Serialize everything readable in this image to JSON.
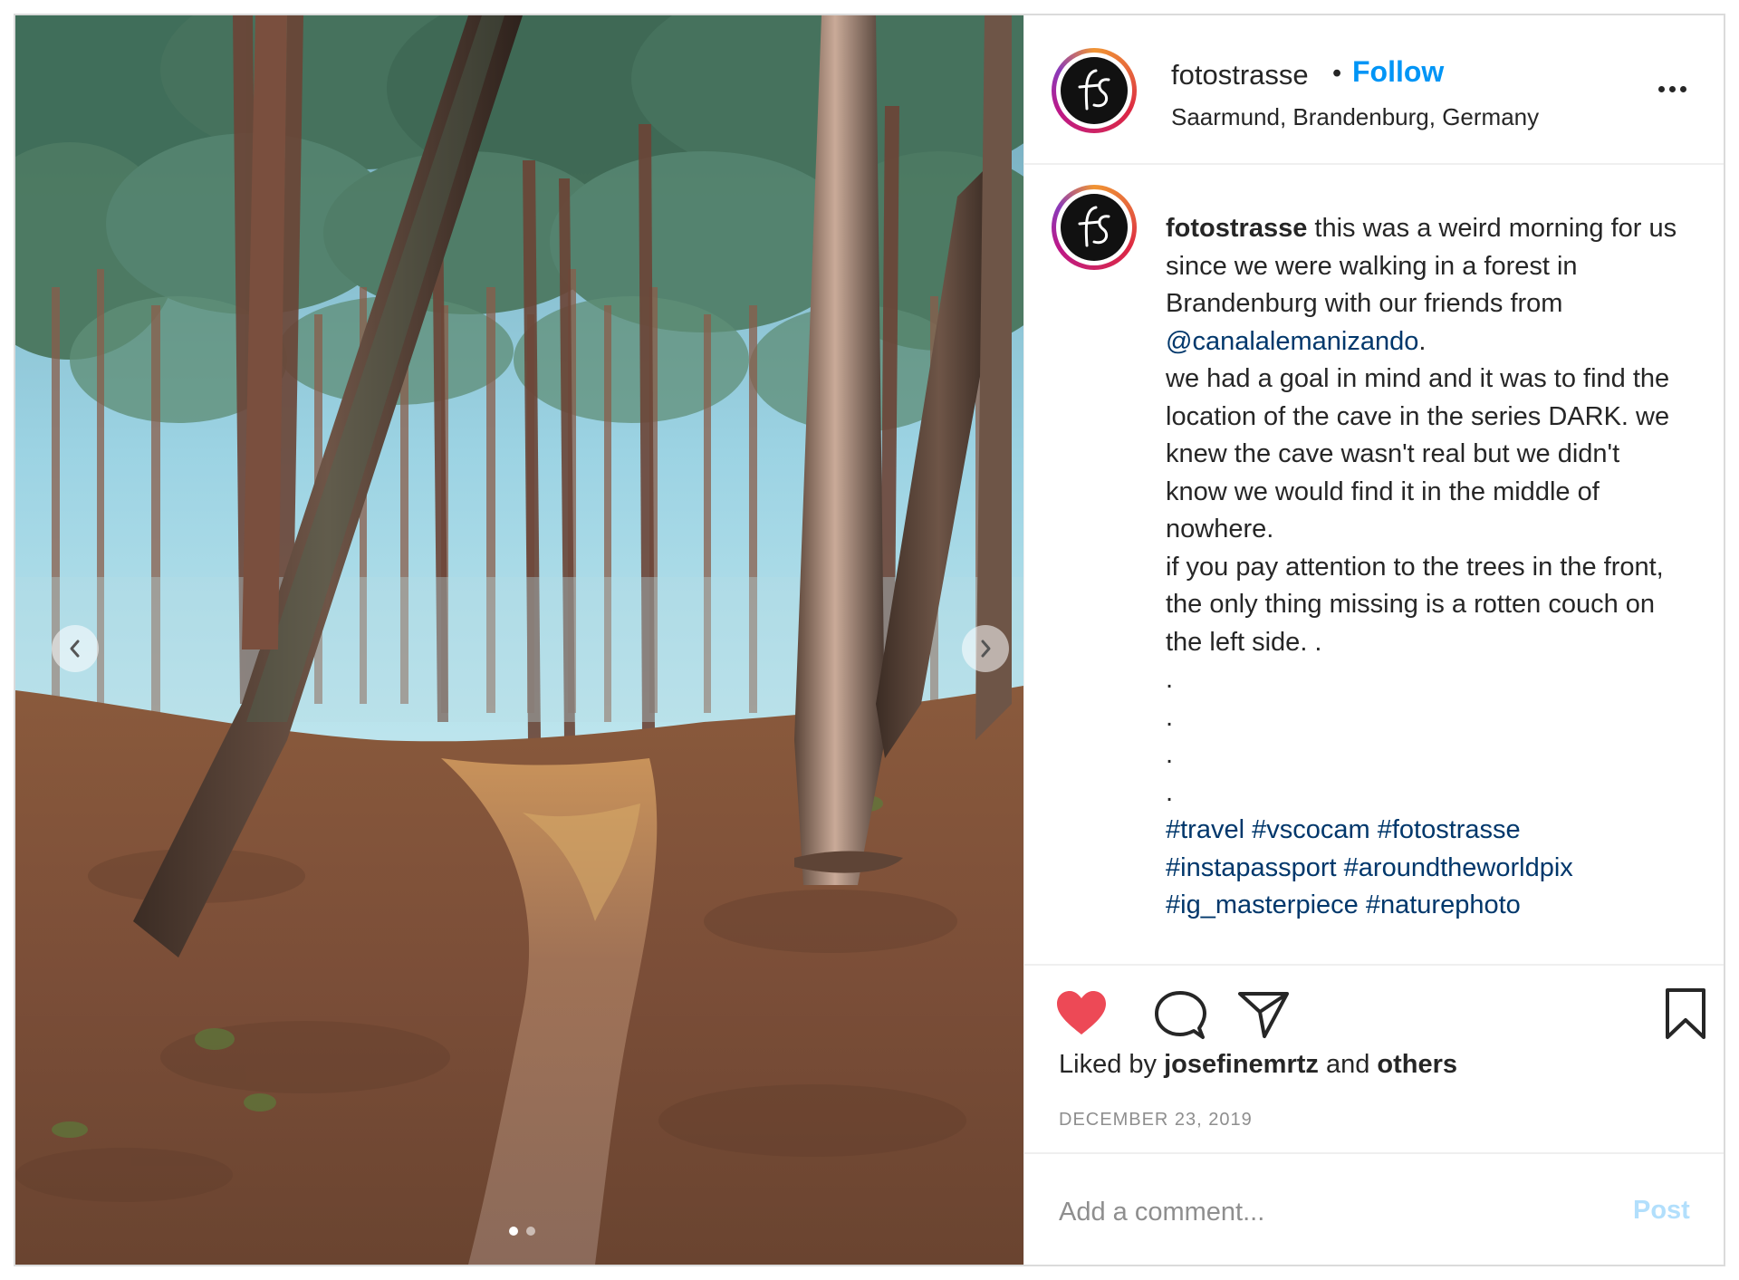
{
  "header": {
    "username": "fotostrasse",
    "separator": "•",
    "follow_label": "Follow",
    "location": "Saarmund, Brandenburg, Germany",
    "avatar_text": "fS"
  },
  "caption": {
    "username": "fotostrasse",
    "line1": " this was a weird morning for us since we were walking in a forest in Brandenburg with our friends from ",
    "mention": "@canalalemanizando",
    "line1_end": ".",
    "line2": "we had a goal in mind and it was to find the location of the cave in the series DARK. we knew the cave wasn't real but we didn't know we would find it in the middle of nowhere.",
    "line3": "if you pay attention to the trees in the front, the only thing missing is a rotten couch on the left side. .",
    "dots": [
      ".",
      ".",
      ".",
      "."
    ],
    "hashtags": "#travel #vscocam #fotostrasse #instapassport #aroundtheworldpix #ig_masterpiece #naturephoto"
  },
  "likes": {
    "prefix": "Liked by ",
    "user": "josefinemrtz",
    "middle": " and ",
    "others": "others"
  },
  "date": "DECEMBER 23, 2019",
  "comment": {
    "placeholder": "Add a comment...",
    "post_label": "Post"
  },
  "icons": {
    "like": "heart-icon",
    "comment": "comment-icon",
    "share": "paper-plane-icon",
    "save": "bookmark-icon",
    "prev": "chevron-left-icon",
    "next": "chevron-right-icon",
    "more": "more-horizontal-icon"
  },
  "colors": {
    "accent": "#0095f6",
    "like": "#ed4956",
    "mention": "#00376b",
    "post_disabled": "#b2dffc",
    "muted": "#8e8e8e"
  },
  "carousel": {
    "total_slides": 2,
    "active_slide": 1
  }
}
